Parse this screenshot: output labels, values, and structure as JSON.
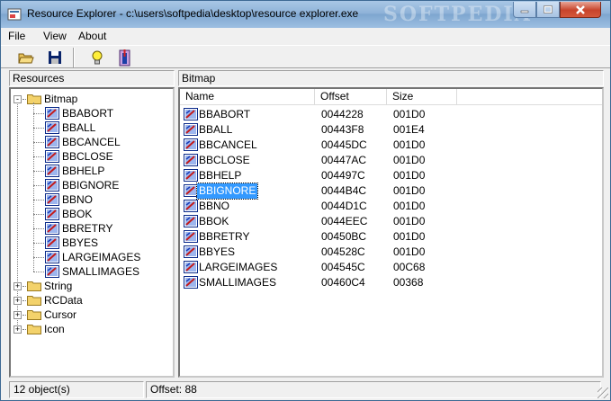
{
  "window": {
    "title": "Resource Explorer - c:\\users\\softpedia\\desktop\\resource explorer.exe",
    "watermark": "SOFTPEDIA"
  },
  "menu": [
    "File",
    "View",
    "About"
  ],
  "toolbar": {
    "icons": [
      "open-folder-icon",
      "save-disk-icon",
      "lightbulb-icon",
      "exit-door-icon"
    ]
  },
  "left_panel": {
    "header": "Resources",
    "tree": {
      "bitmap_label": "Bitmap",
      "bitmap_children": [
        "BBABORT",
        "BBALL",
        "BBCANCEL",
        "BBCLOSE",
        "BBHELP",
        "BBIGNORE",
        "BBNO",
        "BBOK",
        "BBRETRY",
        "BBYES",
        "LARGEIMAGES",
        "SMALLIMAGES"
      ],
      "collapsed": [
        "String",
        "RCData",
        "Cursor",
        "Icon"
      ]
    }
  },
  "right_panel": {
    "header": "Bitmap",
    "columns": [
      "Name",
      "Offset",
      "Size"
    ],
    "selected_row": 5,
    "rows": [
      [
        "BBABORT",
        "0044228",
        "001D0"
      ],
      [
        "BBALL",
        "00443F8",
        "001E4"
      ],
      [
        "BBCANCEL",
        "00445DC",
        "001D0"
      ],
      [
        "BBCLOSE",
        "00447AC",
        "001D0"
      ],
      [
        "BBHELP",
        "004497C",
        "001D0"
      ],
      [
        "BBIGNORE",
        "0044B4C",
        "001D0"
      ],
      [
        "BBNO",
        "0044D1C",
        "001D0"
      ],
      [
        "BBOK",
        "0044EEC",
        "001D0"
      ],
      [
        "BBRETRY",
        "00450BC",
        "001D0"
      ],
      [
        "BBYES",
        "004528C",
        "001D0"
      ],
      [
        "LARGEIMAGES",
        "004545C",
        "00C68"
      ],
      [
        "SMALLIMAGES",
        "00460C4",
        "00368"
      ]
    ]
  },
  "status": {
    "objects": "12 object(s)",
    "offset": "Offset: 88"
  },
  "colors": {
    "selection": "#3399ff",
    "title_bar": "#8fb3d8",
    "close_button": "#c7442b"
  }
}
